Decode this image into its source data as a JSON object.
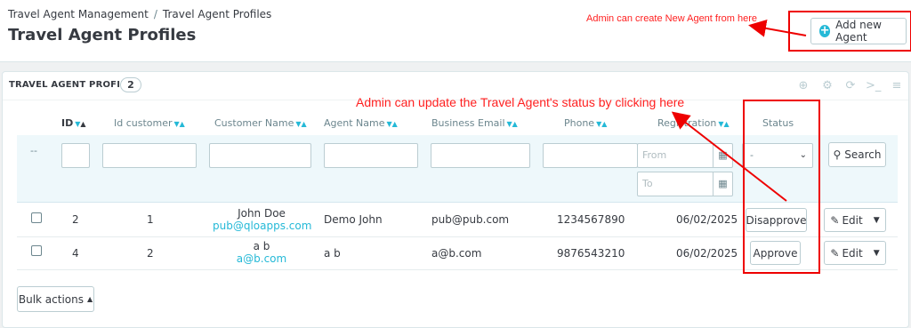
{
  "breadcrumb": {
    "parent": "Travel Agent Management",
    "separator": "/",
    "current": "Travel Agent Profiles"
  },
  "page_title": "Travel Agent Profiles",
  "toolbar": {
    "add_label": "Add new Agent"
  },
  "annotations": {
    "add": "Admin can create New Agent from here",
    "status": "Admin can update the Travel Agent's status by clicking here"
  },
  "panel": {
    "title": "TRAVEL AGENT PROFILES",
    "count": "2"
  },
  "columns": {
    "id": "ID",
    "id_customer": "Id customer",
    "customer_name": "Customer Name",
    "agent_name": "Agent Name",
    "business_email": "Business Email",
    "phone": "Phone",
    "registration": "Registration",
    "status": "Status"
  },
  "filters": {
    "dash": "--",
    "date_from_placeholder": "From",
    "date_to_placeholder": "To",
    "status_selected": "-",
    "search_label": "Search"
  },
  "rows": [
    {
      "id": "2",
      "id_customer": "1",
      "customer_name": "John Doe",
      "customer_email": "pub@qloapps.com",
      "agent_name": "Demo John",
      "business_email": "pub@pub.com",
      "phone": "1234567890",
      "registration": "06/02/2025",
      "status_action": "Disapprove",
      "edit_label": "Edit"
    },
    {
      "id": "4",
      "id_customer": "2",
      "customer_name": "a b",
      "customer_email": "a@b.com",
      "agent_name": "a b",
      "business_email": "a@b.com",
      "phone": "9876543210",
      "registration": "06/02/2025",
      "status_action": "Approve",
      "edit_label": "Edit"
    }
  ],
  "bulk_actions": {
    "label": "Bulk actions"
  },
  "colors": {
    "accent": "#25b9d7",
    "annotation": "#ff2020",
    "text": "#363a41"
  }
}
